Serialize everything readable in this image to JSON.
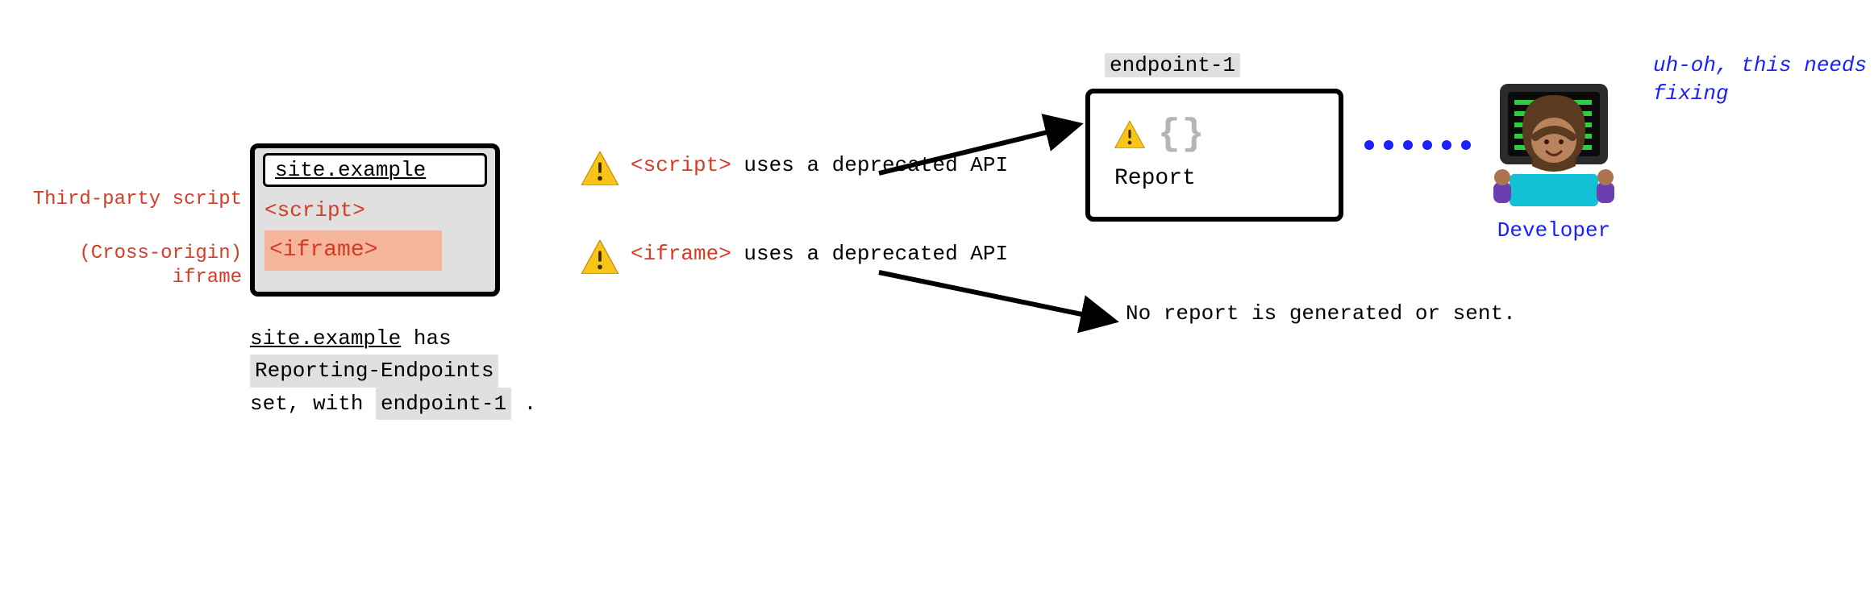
{
  "site": {
    "url": "site.example",
    "script_tag": "<script>",
    "iframe_tag": "<iframe>",
    "label_third_party": "Third-party script",
    "label_cross_origin": "(Cross-origin) iframe",
    "caption_pre": "site.example",
    "caption_mid": " has ",
    "caption_code": "Reporting-Endpoints",
    "caption_line2a": "set, with ",
    "caption_line2b": "endpoint-1",
    "caption_line2c": " ."
  },
  "messages": {
    "script_code": "<script>",
    "script_text": " uses a deprecated API",
    "iframe_code": "<iframe>",
    "iframe_text": " uses a deprecated API"
  },
  "endpoint": {
    "name": "endpoint-1",
    "report_label": "Report",
    "no_report": "No report is generated or sent."
  },
  "icons": {
    "warning": "warning-icon",
    "braces": "{}"
  },
  "developer": {
    "label": "Developer",
    "thought": "uh-oh, this needs fixing"
  }
}
